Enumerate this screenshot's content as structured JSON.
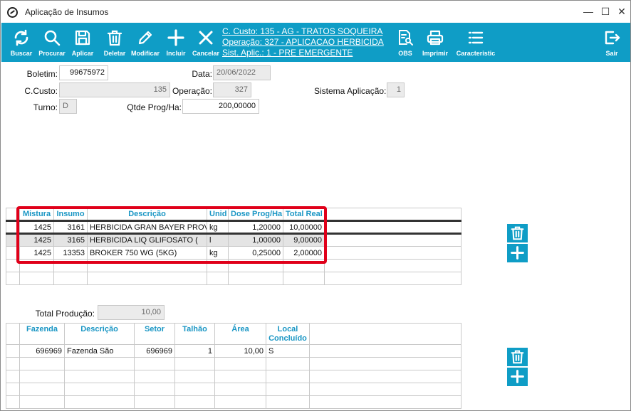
{
  "window": {
    "title": "Aplicação de Insumos",
    "minimize_glyph": "—",
    "maximize_glyph": "☐",
    "close_glyph": "✕"
  },
  "toolbar": {
    "buscar": "Buscar",
    "procurar": "Procurar",
    "aplicar": "Aplicar",
    "deletar": "Deletar",
    "modificar": "Modificar",
    "incluir": "Incluir",
    "cancelar": "Cancelar",
    "obs": "OBS",
    "imprimir": "Imprimir",
    "caracteristic": "Caracteristic",
    "sair": "Sair",
    "info_custo": "C. Custo: 135 - AG - TRATOS SOQUEIRA",
    "info_operacao": "Operação: 327 - APLICACAO HERBICIDA",
    "info_sist": "Sist. Aplic.: 1 - PRE EMERGENTE",
    "accent_color": "#0f9dc6"
  },
  "form": {
    "boletim_label": "Boletim:",
    "boletim_value": "99675972",
    "data_label": "Data:",
    "data_value": "20/06/2022",
    "ccusto_label": "C.Custo:",
    "ccusto_value": "135",
    "operacao_label": "Operação:",
    "operacao_value": "327",
    "sistema_label": "Sistema Aplicação:",
    "sistema_value": "1",
    "turno_label": "Turno:",
    "turno_value": "D",
    "qtde_label": "Qtde Prog/Ha:",
    "qtde_value": "200,00000"
  },
  "insumos_grid": {
    "headers": [
      "Mistura",
      "Insumo",
      "Descrição",
      "Unid",
      "Dose Prog/Ha",
      "Total Real"
    ],
    "rows": [
      [
        "1425",
        "3161",
        "HERBICIDA GRAN BAYER PROV",
        "kg",
        "1,20000",
        "10,00000"
      ],
      [
        "1425",
        "3165",
        "HERBICIDA LIQ GLIFOSATO (",
        "l",
        "1,00000",
        "9,00000"
      ],
      [
        "1425",
        "13353",
        "BROKER 750 WG (5KG)",
        "kg",
        "0,25000",
        "2,00000"
      ]
    ],
    "highlight_color": "#e0001a"
  },
  "producao": {
    "total_label": "Total Produção:",
    "total_value": "10,00"
  },
  "producao_grid": {
    "headers": [
      "Fazenda",
      "Descrição",
      "Setor",
      "Talhão",
      "Área",
      "Local Concluído"
    ],
    "rows": [
      [
        "696969",
        "Fazenda São",
        "696969",
        "1",
        "10,00",
        "S"
      ]
    ]
  },
  "side_buttons": {
    "delete_icon": "trash-icon",
    "add_icon": "plus-icon"
  }
}
